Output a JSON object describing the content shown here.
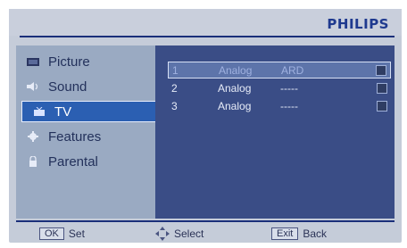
{
  "brand": "PHILIPS",
  "menu": [
    {
      "label": "Picture",
      "icon": "picture-icon"
    },
    {
      "label": "Sound",
      "icon": "speaker-icon"
    },
    {
      "label": "TV",
      "icon": "tv-icon",
      "selected": true
    },
    {
      "label": "Features",
      "icon": "gear-icon"
    },
    {
      "label": "Parental",
      "icon": "lock-icon"
    }
  ],
  "channels": [
    {
      "number": "1",
      "type": "Analog",
      "name": "ARD"
    },
    {
      "number": "2",
      "type": "Analog",
      "name": "-----"
    },
    {
      "number": "3",
      "type": "Analog",
      "name": "-----"
    }
  ],
  "footer": {
    "ok_key": "OK",
    "ok_label": "Set",
    "select_label": "Select",
    "exit_key": "Exit",
    "exit_label": "Back"
  },
  "colors": {
    "accent": "#2b5fb2",
    "panel": "#3a4d86",
    "brand": "#1f3a8f"
  }
}
